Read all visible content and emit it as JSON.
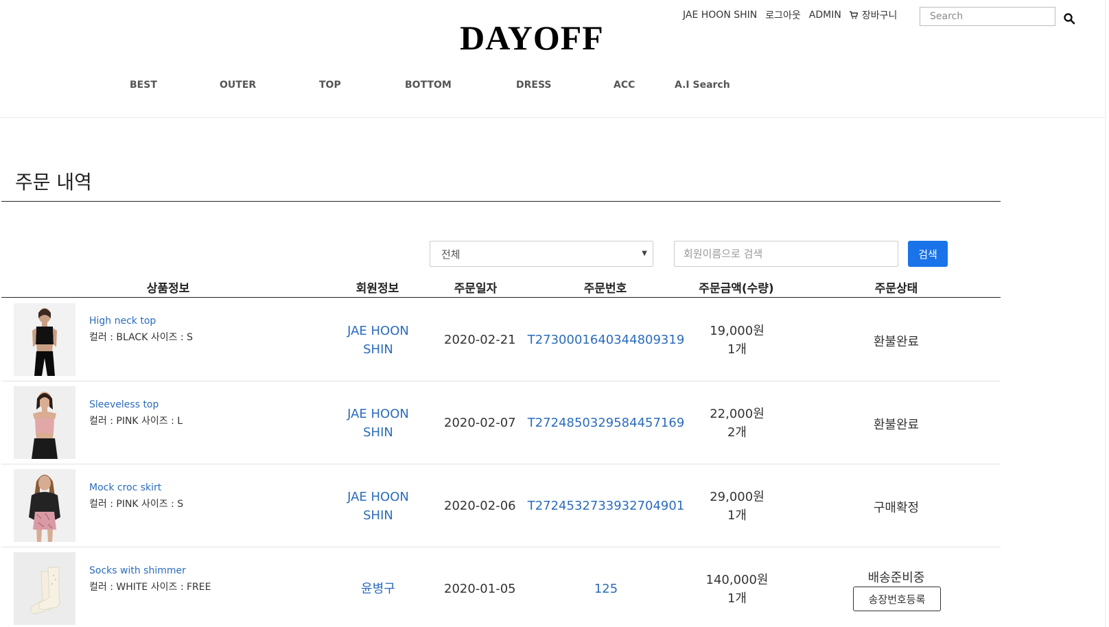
{
  "brand": {
    "logo": "DAYOFF"
  },
  "util": {
    "user": "JAE HOON SHIN",
    "logout": "로그아웃",
    "admin": "ADMIN",
    "cart": "장바구니",
    "search_placeholder": "Search"
  },
  "nav": [
    "BEST",
    "OUTER",
    "TOP",
    "BOTTOM",
    "DRESS",
    "ACC",
    "A.I Search"
  ],
  "page": {
    "title": "주문 내역"
  },
  "filter": {
    "select_value": "전체",
    "member_search_placeholder": "회원이름으로 검색",
    "search_button": "검색"
  },
  "table": {
    "headers": [
      "상품정보",
      "회원정보",
      "주문일자",
      "주문번호",
      "주문금액(수량)",
      "주문상태"
    ],
    "rows": [
      {
        "product": "High neck top",
        "options": "컬러 : BLACK 사이즈 : S",
        "member_line1": "JAE HOON",
        "member_line2": "SHIN",
        "date": "2020-02-21",
        "order_no": "T2730001640344809319",
        "amount": "19,000원",
        "qty": "1개",
        "status": "환불완료"
      },
      {
        "product": "Sleeveless top",
        "options": "컬러 : PINK 사이즈 : L",
        "member_line1": "JAE HOON",
        "member_line2": "SHIN",
        "date": "2020-02-07",
        "order_no": "T2724850329584457169",
        "amount": "22,000원",
        "qty": "2개",
        "status": "환불완료"
      },
      {
        "product": "Mock croc skirt",
        "options": "컬러 : PINK 사이즈 : S",
        "member_line1": "JAE HOON",
        "member_line2": "SHIN",
        "date": "2020-02-06",
        "order_no": "T2724532733932704901",
        "amount": "29,000원",
        "qty": "1개",
        "status": "구매확정"
      },
      {
        "product": "Socks with shimmer",
        "options": "컬러 : WHITE 사이즈 : FREE",
        "member_line1": "윤병구",
        "member_line2": "",
        "date": "2020-01-05",
        "order_no": "125",
        "amount": "140,000원",
        "qty": "1개",
        "status": "배송준비중",
        "action": "송장번호등록"
      }
    ]
  },
  "colors": {
    "link": "#2a6bbd",
    "primary_button": "#1a73e8"
  }
}
